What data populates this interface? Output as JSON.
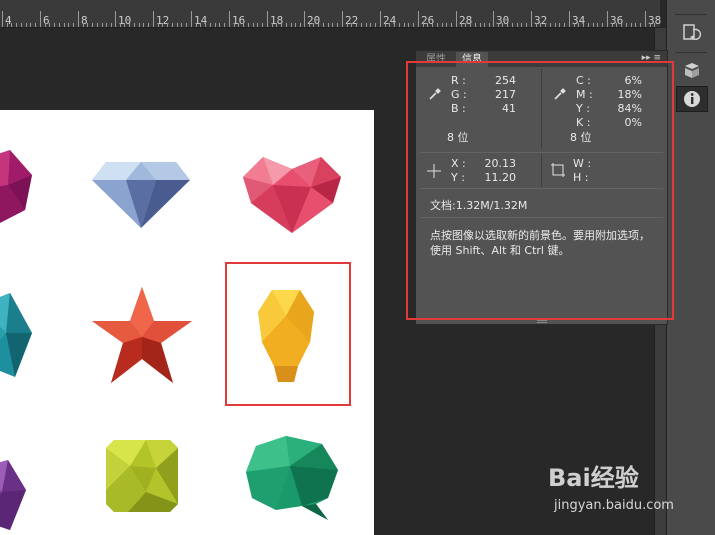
{
  "ruler": {
    "labels": [
      "4",
      "6",
      "8",
      "10",
      "12",
      "14",
      "16",
      "18",
      "20",
      "22",
      "24",
      "26",
      "28",
      "30",
      "32",
      "34",
      "36",
      "38"
    ]
  },
  "panel": {
    "tabs": [
      "属性",
      "信息"
    ],
    "rgb": {
      "r_label": "R :",
      "r": "254",
      "g_label": "G :",
      "g": "217",
      "b_label": "B :",
      "b": "41",
      "bits": "8 位"
    },
    "cmyk": {
      "c_label": "C :",
      "c": "6%",
      "m_label": "M :",
      "m": "18%",
      "y_label": "Y :",
      "y": "84%",
      "k_label": "K :",
      "k": "0%",
      "bits": "8 位"
    },
    "coords": {
      "x_label": "X :",
      "x": "20.13",
      "y_label": "Y :",
      "y": "11.20"
    },
    "size": {
      "w_label": "W :",
      "h_label": "H :"
    },
    "doc": "文档:1.32M/1.32M",
    "hint": "点按图像以选取新的前景色。要用附加选项，使用 Shift、Alt 和 Ctrl 键。"
  },
  "watermark": {
    "brand": "Bai经验",
    "url": "jingyan.baidu.com"
  },
  "colors": {
    "highlight": "#e03a3a",
    "panel": "#535353",
    "workspace": "#282828"
  }
}
